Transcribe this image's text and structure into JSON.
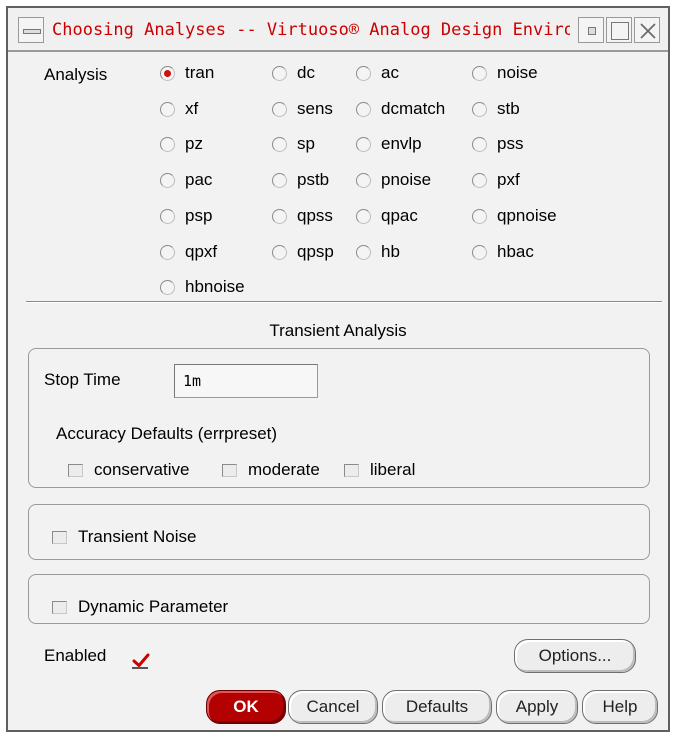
{
  "window": {
    "title": "Choosing Analyses -- Virtuoso® Analog Design Environment"
  },
  "analysis": {
    "label": "Analysis",
    "selected": "tran",
    "options": [
      "tran",
      "dc",
      "ac",
      "noise",
      "xf",
      "sens",
      "dcmatch",
      "stb",
      "pz",
      "sp",
      "envlp",
      "pss",
      "pac",
      "pstb",
      "pnoise",
      "pxf",
      "psp",
      "qpss",
      "qpac",
      "qpnoise",
      "qpxf",
      "qpsp",
      "hb",
      "hbac",
      "hbnoise"
    ]
  },
  "transient": {
    "section_title": "Transient Analysis",
    "stop_time_label": "Stop Time",
    "stop_time_value": "1m",
    "accuracy_label": "Accuracy Defaults (errpreset)",
    "accuracy_options": [
      "conservative",
      "moderate",
      "liberal"
    ],
    "transient_noise_label": "Transient Noise",
    "dynamic_parameter_label": "Dynamic Parameter",
    "enabled_label": "Enabled",
    "enabled_checked": true,
    "options_button": "Options..."
  },
  "buttons": {
    "ok": "OK",
    "cancel": "Cancel",
    "defaults": "Defaults",
    "apply": "Apply",
    "help": "Help"
  },
  "colors": {
    "title_text": "#cc0000",
    "radio_selected": "#cc1111",
    "ok_button": "#b30000",
    "check_mark": "#cc0000"
  }
}
